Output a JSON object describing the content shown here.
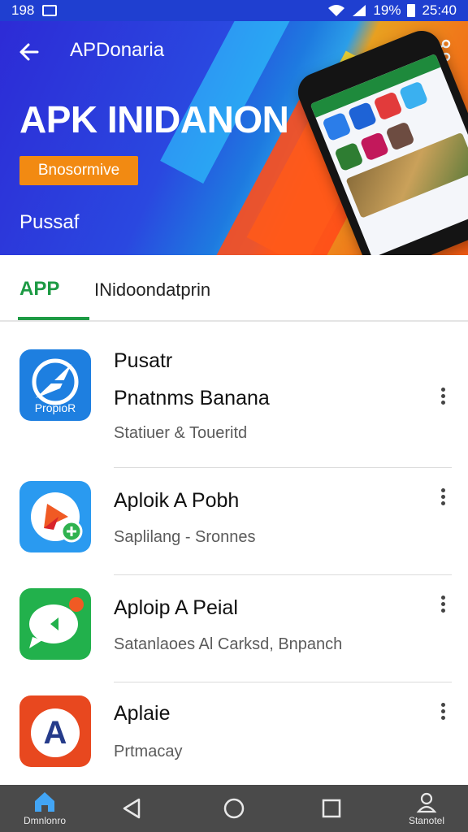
{
  "status_bar": {
    "time_left": "198",
    "battery": "19%",
    "time_right": "25:40"
  },
  "header": {
    "title": "APDonaria",
    "back_icon": "arrow-left-icon",
    "share_icon": "share-icon"
  },
  "hero": {
    "headline": "APK INIDANON",
    "badge": "Bnosormive",
    "subtitle": "Pussaf"
  },
  "tabs": [
    {
      "label": "APP",
      "active": true
    },
    {
      "label": "INidoondatprin",
      "active": false
    }
  ],
  "apps": [
    {
      "title": "Pusatr",
      "title2": "Pnatnms Banana",
      "subtitle": "Statiuer & Toueritd",
      "icon_text": "PropioR",
      "icon": "compass-icon",
      "color": "#1e7fe0"
    },
    {
      "title": "Aploik A Pobh",
      "subtitle": "Saplilang - Sronnes",
      "icon": "play-icon",
      "color": "#2a9af0"
    },
    {
      "title": "Aploip A Peial",
      "subtitle": "Satanlaoes Al Carksd, Bnpanch",
      "icon": "chat-icon",
      "color": "#22b14c"
    },
    {
      "title": "Aplaie",
      "subtitle": "Prtmacay",
      "icon_text": "A",
      "icon": "letter-a-icon",
      "color": "#e8481f"
    }
  ],
  "nav": {
    "home_label": "Dmnlonro",
    "back_icon": "triangle-back-icon",
    "home_circle_icon": "circle-home-icon",
    "recents_icon": "square-recents-icon",
    "profile_label": "Stanotel"
  },
  "colors": {
    "accent_green": "#1d9a44",
    "hero_blue": "#2a48e0",
    "hero_orange": "#f07a1a",
    "badge_orange": "#f28a12"
  }
}
